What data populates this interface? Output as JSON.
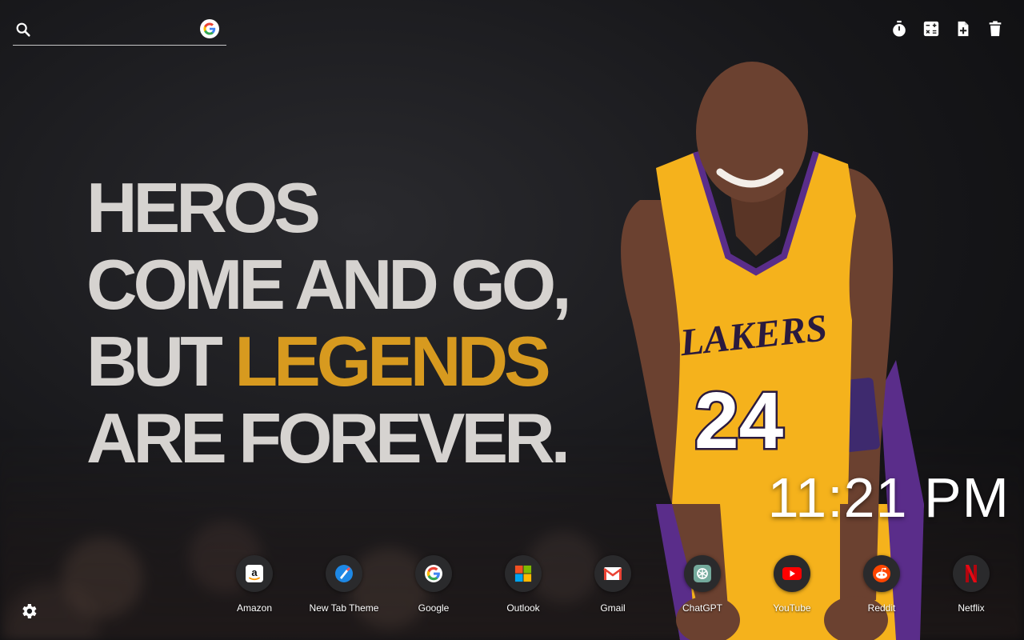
{
  "search": {
    "placeholder": "",
    "value": "",
    "engine_icon": "google-icon"
  },
  "toolbar": {
    "icons": [
      "timer-icon",
      "calculator-icon",
      "note-add-icon",
      "trash-icon"
    ]
  },
  "quote": {
    "line1": "HEROS",
    "line2": "COME AND GO,",
    "line3_pre": "BUT ",
    "line3_accent": "LEGENDS",
    "line4": "ARE FOREVER.",
    "text_color": "#d6d3d0",
    "accent_color": "#d79a1f"
  },
  "player": {
    "jersey_team": "LAKERS",
    "jersey_number": "24",
    "jersey_color": "#f5b21c",
    "trim_color": "#5a2d8a"
  },
  "clock": {
    "time": "11:21 PM"
  },
  "shortcuts": [
    {
      "label": "Amazon",
      "icon": "amazon-icon"
    },
    {
      "label": "New Tab Theme",
      "icon": "new-tab-theme-icon"
    },
    {
      "label": "Google",
      "icon": "google-icon"
    },
    {
      "label": "Outlook",
      "icon": "outlook-icon"
    },
    {
      "label": "Gmail",
      "icon": "gmail-icon"
    },
    {
      "label": "ChatGPT",
      "icon": "chatgpt-icon"
    },
    {
      "label": "YouTube",
      "icon": "youtube-icon"
    },
    {
      "label": "Reddit",
      "icon": "reddit-icon"
    },
    {
      "label": "Netflix",
      "icon": "netflix-icon"
    }
  ],
  "settings": {
    "icon": "gear-icon"
  }
}
